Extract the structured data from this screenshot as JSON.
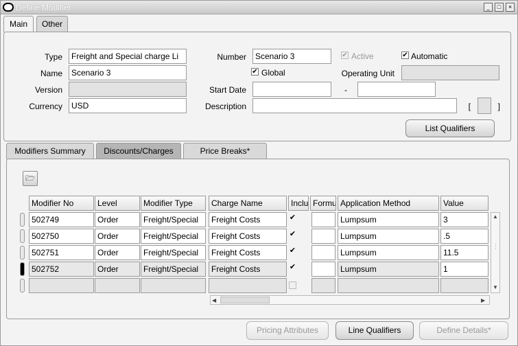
{
  "window": {
    "title": "Define Modifier",
    "controls": [
      "_",
      "□",
      "×"
    ]
  },
  "top_tabs": [
    {
      "label": "Main",
      "active": true
    },
    {
      "label": "Other",
      "active": false
    }
  ],
  "header": {
    "type_label": "Type",
    "type_value": "Freight and Special charge Li",
    "number_label": "Number",
    "number_value": "Scenario 3",
    "active_label": "Active",
    "active_checked": true,
    "automatic_label": "Automatic",
    "automatic_checked": true,
    "name_label": "Name",
    "name_value": "Scenario 3",
    "global_label": "Global",
    "global_checked": true,
    "operating_unit_label": "Operating Unit",
    "operating_unit_value": "",
    "version_label": "Version",
    "version_value": "",
    "start_date_label": "Start Date",
    "start_date_value": "",
    "date_separator": "-",
    "end_date_value": "",
    "currency_label": "Currency",
    "currency_value": "USD",
    "description_label": "Description",
    "description_value": "",
    "flex_open": "[",
    "flex_close": "]",
    "list_qualifiers_label": "List Qualifiers"
  },
  "lines_tabs": [
    {
      "label": "Modifiers Summary",
      "active": false
    },
    {
      "label": "Discounts/Charges",
      "active": true
    },
    {
      "label": "Price Breaks*",
      "active": false
    }
  ],
  "table": {
    "columns": [
      "Modifier No",
      "Level",
      "Modifier Type",
      "Charge Name",
      "Inclu",
      "Formu",
      "Application Method",
      "Value"
    ],
    "rows": [
      {
        "modifier_no": "502749",
        "level": "Order",
        "modifier_type": "Freight/Special",
        "charge_name": "Freight Costs",
        "include": true,
        "formula": "",
        "application_method": "Lumpsum",
        "value": "3"
      },
      {
        "modifier_no": "502750",
        "level": "Order",
        "modifier_type": "Freight/Special",
        "charge_name": "Freight Costs",
        "include": true,
        "formula": "",
        "application_method": "Lumpsum",
        "value": ".5"
      },
      {
        "modifier_no": "502751",
        "level": "Order",
        "modifier_type": "Freight/Special",
        "charge_name": "Freight Costs",
        "include": true,
        "formula": "",
        "application_method": "Lumpsum",
        "value": "11.5"
      },
      {
        "modifier_no": "502752",
        "level": "Order",
        "modifier_type": "Freight/Special",
        "charge_name": "Freight Costs",
        "include": true,
        "formula": "",
        "application_method": "Lumpsum",
        "value": "1"
      }
    ]
  },
  "footer": {
    "pricing_attributes_label": "Pricing Attributes",
    "line_qualifiers_label": "Line Qualifiers",
    "define_details_label": "Define Details*"
  }
}
